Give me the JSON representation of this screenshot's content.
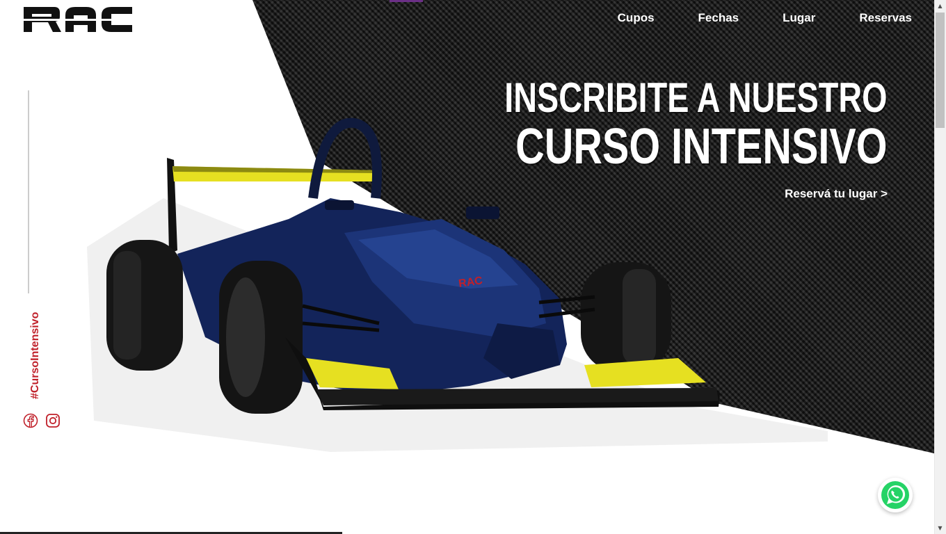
{
  "brand": {
    "logo_text": "RAC"
  },
  "nav": {
    "items": [
      {
        "label": "Cupos"
      },
      {
        "label": "Fechas"
      },
      {
        "label": "Lugar"
      },
      {
        "label": "Reservas"
      }
    ]
  },
  "hero": {
    "line1": "INSCRIBITE A NUESTRO",
    "line2": "CURSO INTENSIVO",
    "cta": "Reservá tu lugar >"
  },
  "sidebar": {
    "hashtag": "#CursoIntensivo",
    "social": [
      {
        "icon": "facebook-icon"
      },
      {
        "icon": "instagram-icon"
      }
    ]
  },
  "car": {
    "livery_text": "RAC"
  },
  "floating": {
    "icon": "whatsapp-icon"
  },
  "colors": {
    "accent_red": "#c0202a",
    "carbon": "#1b1b1b",
    "car_blue": "#13245a",
    "wing_yellow": "#e6e021",
    "whatsapp_green": "#25d366"
  }
}
